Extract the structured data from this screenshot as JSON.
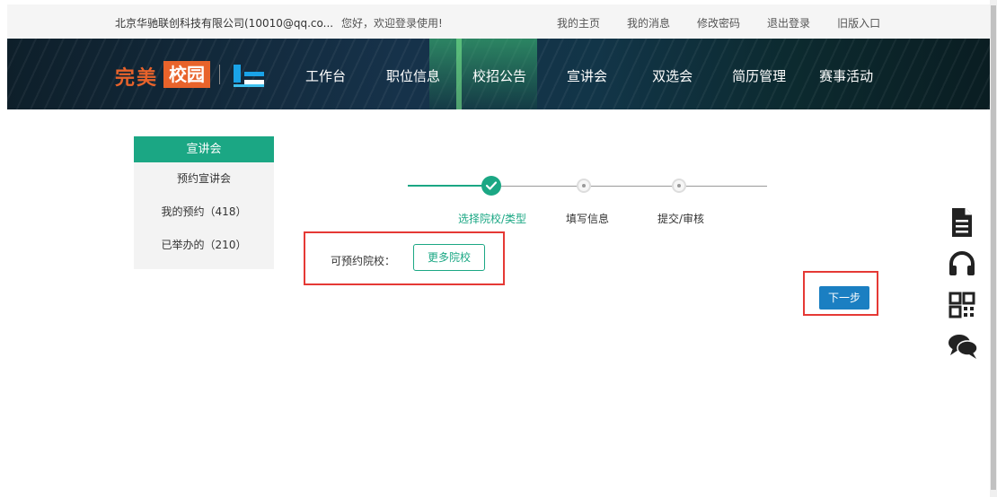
{
  "topbar": {
    "company": "北京华驰联创科技有限公司(10010@qq.co...",
    "greeting": "您好，欢迎登录使用!",
    "links": [
      "我的主页",
      "我的消息",
      "修改密码",
      "退出登录",
      "旧版入口"
    ]
  },
  "logo": {
    "word1": "完美",
    "word2": "校园"
  },
  "nav": [
    "工作台",
    "职位信息",
    "校招公告",
    "宣讲会",
    "双选会",
    "简历管理",
    "赛事活动"
  ],
  "sidebar": {
    "title": "宣讲会",
    "items": [
      "预约宣讲会",
      "我的预约（418）",
      "已举办的（210）"
    ]
  },
  "steps": [
    {
      "label": "选择院校/类型",
      "state": "done"
    },
    {
      "label": "填写信息",
      "state": "pending"
    },
    {
      "label": "提交/审核",
      "state": "pending"
    }
  ],
  "form": {
    "school_label": "可预约院校：",
    "more_schools": "更多院校",
    "next": "下一步"
  },
  "colors": {
    "accent": "#1ba784",
    "primary": "#1b7fc2",
    "highlight": "#e53935",
    "logo": "#e8632b"
  },
  "tools": [
    "document-icon",
    "headset-icon",
    "qrcode-icon",
    "chat-icon"
  ]
}
